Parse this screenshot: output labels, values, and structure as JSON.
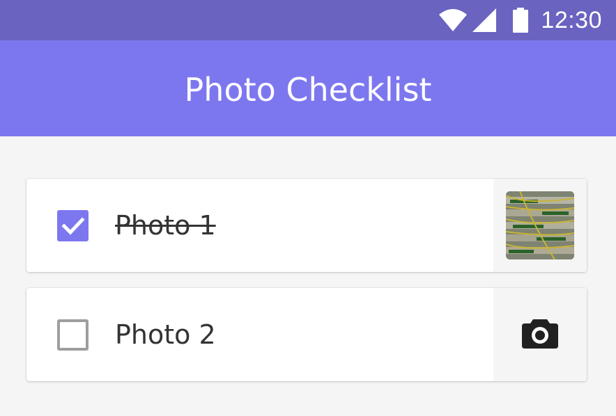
{
  "status_bar": {
    "time": "12:30",
    "icons": [
      "wifi-icon",
      "signal-icon",
      "battery-icon"
    ]
  },
  "app_bar": {
    "title": "Photo Checklist"
  },
  "items": [
    {
      "label": "Photo 1",
      "checked": true,
      "media": "photo-thumbnail"
    },
    {
      "label": "Photo 2",
      "checked": false,
      "media": "camera-icon"
    }
  ],
  "colors": {
    "status_bar": "#6a63c0",
    "primary": "#7d77ef",
    "background": "#f5f5f5",
    "text": "#333333",
    "unchecked_border": "#9e9e9e"
  }
}
